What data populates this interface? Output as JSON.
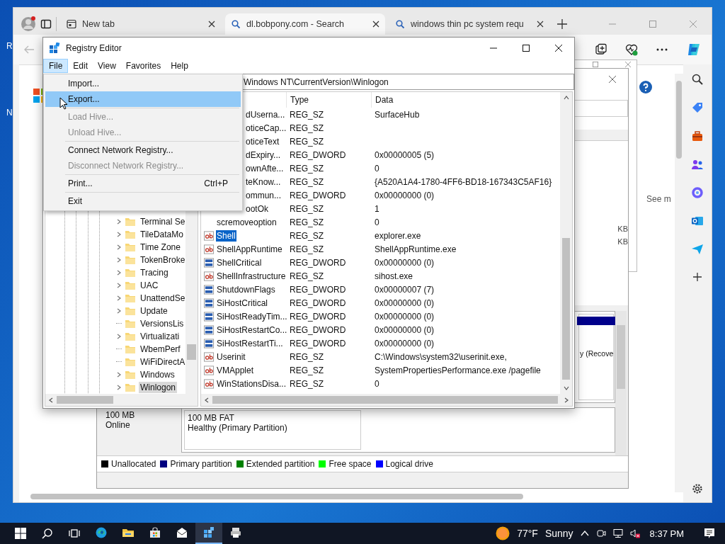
{
  "desktop": {
    "icon_labels": [
      "R",
      "N"
    ]
  },
  "browser": {
    "tabs": [
      {
        "label": "New tab",
        "kind": "newtab",
        "selected": false
      },
      {
        "label": "dl.bobpony.com - Search",
        "kind": "search",
        "selected": true
      },
      {
        "label": "windows thin pc system requ",
        "kind": "search",
        "selected": false
      }
    ],
    "page_text": "See m"
  },
  "disk_management": {
    "size_texts": [
      "KB",
      "KB"
    ],
    "disk": {
      "size": "100 MB",
      "status": "Online"
    },
    "partition": {
      "title": "100 MB FAT",
      "status": "Healthy (Primary Partition)"
    },
    "recovery_partition_text": "y (Recove",
    "legend": [
      {
        "label": "Unallocated",
        "color": "#000000"
      },
      {
        "label": "Primary partition",
        "color": "#000080"
      },
      {
        "label": "Extended partition",
        "color": "#008000"
      },
      {
        "label": "Free space",
        "color": "#00ff00"
      },
      {
        "label": "Logical drive",
        "color": "#0000ff"
      }
    ]
  },
  "registry_editor": {
    "title": "Registry Editor",
    "menu": [
      {
        "label": "File",
        "selected": true
      },
      {
        "label": "Edit",
        "selected": false
      },
      {
        "label": "View",
        "selected": false
      },
      {
        "label": "Favorites",
        "selected": false
      },
      {
        "label": "Help",
        "selected": false
      }
    ],
    "address": "Windows NT\\CurrentVersion\\Winlogon",
    "file_menu": [
      {
        "kind": "item",
        "label": "Import...",
        "selected": false,
        "disabled": false
      },
      {
        "kind": "item",
        "label": "Export...",
        "selected": true,
        "disabled": false
      },
      {
        "kind": "separator"
      },
      {
        "kind": "item",
        "label": "Load Hive...",
        "selected": false,
        "disabled": true
      },
      {
        "kind": "item",
        "label": "Unload Hive...",
        "selected": false,
        "disabled": true
      },
      {
        "kind": "separator"
      },
      {
        "kind": "item",
        "label": "Connect Network Registry...",
        "selected": false,
        "disabled": false
      },
      {
        "kind": "item",
        "label": "Disconnect Network Registry...",
        "selected": false,
        "disabled": true
      },
      {
        "kind": "separator"
      },
      {
        "kind": "item",
        "label": "Print...",
        "shortcut": "Ctrl+P",
        "selected": false,
        "disabled": false
      },
      {
        "kind": "separator"
      },
      {
        "kind": "item",
        "label": "Exit",
        "selected": false,
        "disabled": false
      }
    ],
    "tree": [
      {
        "label": "Terminal Se",
        "expandable": true,
        "selected": false
      },
      {
        "label": "TileDataMo",
        "expandable": true,
        "selected": false
      },
      {
        "label": "Time Zone",
        "expandable": true,
        "selected": false
      },
      {
        "label": "TokenBroke",
        "expandable": true,
        "selected": false
      },
      {
        "label": "Tracing",
        "expandable": true,
        "selected": false
      },
      {
        "label": "UAC",
        "expandable": true,
        "selected": false
      },
      {
        "label": "UnattendSe",
        "expandable": true,
        "selected": false
      },
      {
        "label": "Update",
        "expandable": true,
        "selected": false
      },
      {
        "label": "VersionsLis",
        "expandable": false,
        "selected": false
      },
      {
        "label": "Virtualizati",
        "expandable": true,
        "selected": false
      },
      {
        "label": "WbemPerf",
        "expandable": false,
        "selected": false
      },
      {
        "label": "WiFiDirectA",
        "expandable": false,
        "selected": false
      },
      {
        "label": "Windows",
        "expandable": true,
        "selected": false
      },
      {
        "label": "Winlogon",
        "expandable": true,
        "selected": true
      }
    ],
    "columns": [
      "Type",
      "Data"
    ],
    "values": [
      {
        "name": "dUserna...",
        "kind": "cut",
        "type": "REG_SZ",
        "data": "SurfaceHub",
        "selected": false
      },
      {
        "name": "oticeCap...",
        "kind": "cut",
        "type": "REG_SZ",
        "selected": false
      },
      {
        "name": "oticeText",
        "kind": "cut",
        "type": "REG_SZ",
        "selected": false
      },
      {
        "name": "dExpiry...",
        "kind": "cut",
        "type": "REG_DWORD",
        "data": "0x00000005 (5)",
        "selected": false
      },
      {
        "name": "ownAfte...",
        "kind": "cut",
        "type": "REG_SZ",
        "data": "0",
        "selected": false
      },
      {
        "name": "teKnow...",
        "kind": "cut",
        "type": "REG_SZ",
        "data": "{A520A1A4-1780-4FF6-BD18-167343C5AF16}",
        "selected": false
      },
      {
        "name": "ommun...",
        "kind": "cut",
        "type": "REG_DWORD",
        "data": "0x00000000 (0)",
        "selected": false
      },
      {
        "name": "ootOk",
        "kind": "cut",
        "type": "REG_SZ",
        "data": "1",
        "selected": false
      },
      {
        "name": "scremoveoption",
        "kind": "plain",
        "type": "REG_SZ",
        "data": "0",
        "selected": false
      },
      {
        "name": "Shell",
        "kind": "sz",
        "type": "REG_SZ",
        "data": "explorer.exe",
        "selected": true
      },
      {
        "name": "ShellAppRuntime",
        "kind": "sz",
        "type": "REG_SZ",
        "data": "ShellAppRuntime.exe",
        "selected": false
      },
      {
        "name": "ShellCritical",
        "kind": "dword",
        "type": "REG_DWORD",
        "data": "0x00000000 (0)",
        "selected": false
      },
      {
        "name": "ShellInfrastructure",
        "kind": "sz",
        "type": "REG_SZ",
        "data": "sihost.exe",
        "selected": false
      },
      {
        "name": "ShutdownFlags",
        "kind": "dword",
        "type": "REG_DWORD",
        "data": "0x00000007 (7)",
        "selected": false
      },
      {
        "name": "SiHostCritical",
        "kind": "dword",
        "type": "REG_DWORD",
        "data": "0x00000000 (0)",
        "selected": false
      },
      {
        "name": "SiHostReadyTim...",
        "kind": "dword",
        "type": "REG_DWORD",
        "data": "0x00000000 (0)",
        "selected": false
      },
      {
        "name": "SiHostRestartCo...",
        "kind": "dword",
        "type": "REG_DWORD",
        "data": "0x00000000 (0)",
        "selected": false
      },
      {
        "name": "SiHostRestartTi...",
        "kind": "dword",
        "type": "REG_DWORD",
        "data": "0x00000000 (0)",
        "selected": false
      },
      {
        "name": "Userinit",
        "kind": "sz",
        "type": "REG_SZ",
        "data": "C:\\Windows\\system32\\userinit.exe,",
        "selected": false
      },
      {
        "name": "VMApplet",
        "kind": "sz",
        "type": "REG_SZ",
        "data": "SystemPropertiesPerformance.exe /pagefile",
        "selected": false
      },
      {
        "name": "WinStationsDisa...",
        "kind": "sz",
        "type": "REG_SZ",
        "data": "0",
        "selected": false
      }
    ]
  },
  "taskbar": {
    "apps": [
      {
        "kind": "edge",
        "selected": false
      },
      {
        "kind": "explorer",
        "selected": false
      },
      {
        "kind": "store",
        "selected": false
      },
      {
        "kind": "mail",
        "selected": false
      },
      {
        "kind": "regedit",
        "selected": true
      },
      {
        "kind": "app",
        "selected": false
      }
    ],
    "temperature": "77°F",
    "weather": "Sunny",
    "time": "8:37 PM"
  }
}
